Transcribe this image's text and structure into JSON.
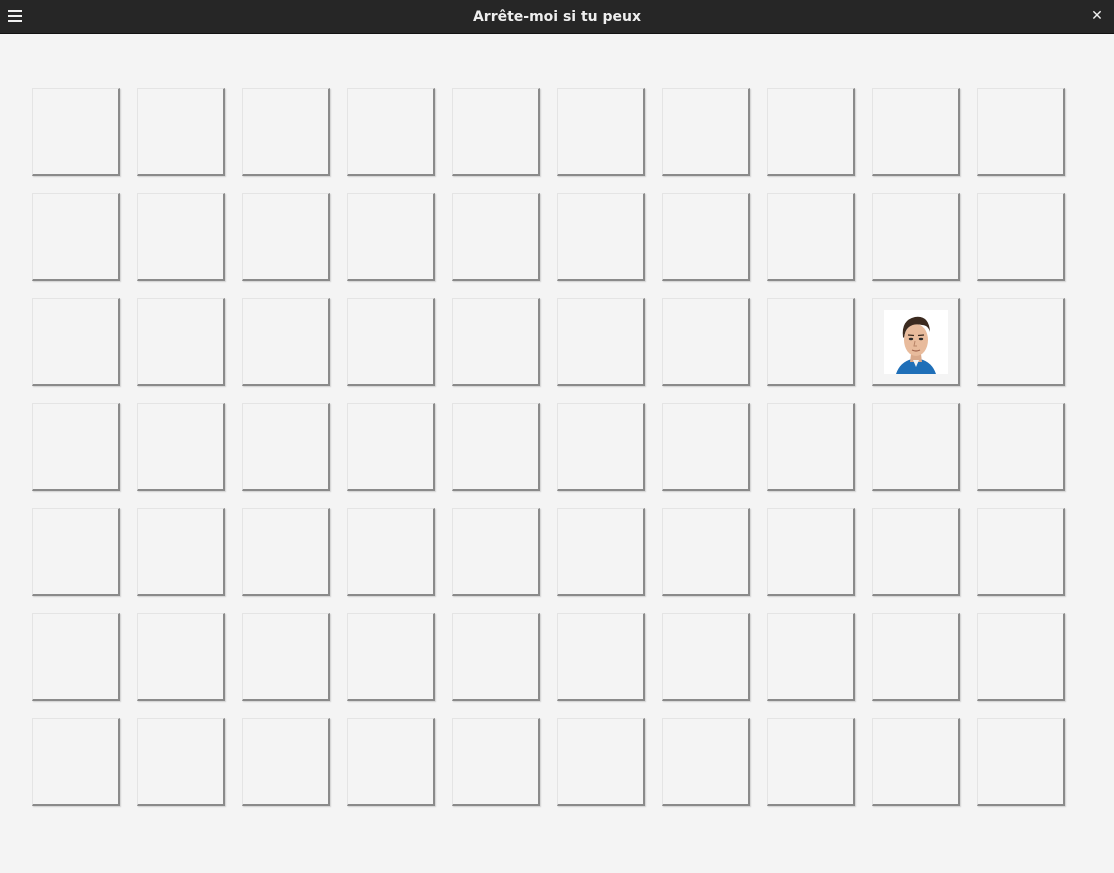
{
  "window": {
    "title": "Arrête-moi si tu peux",
    "menu_icon": "hamburger-menu-icon",
    "close_icon": "close-icon",
    "close_glyph": "✕"
  },
  "board": {
    "rows": 7,
    "cols": 10,
    "target": {
      "row": 2,
      "col": 8,
      "content": "portrait-of-man"
    }
  }
}
